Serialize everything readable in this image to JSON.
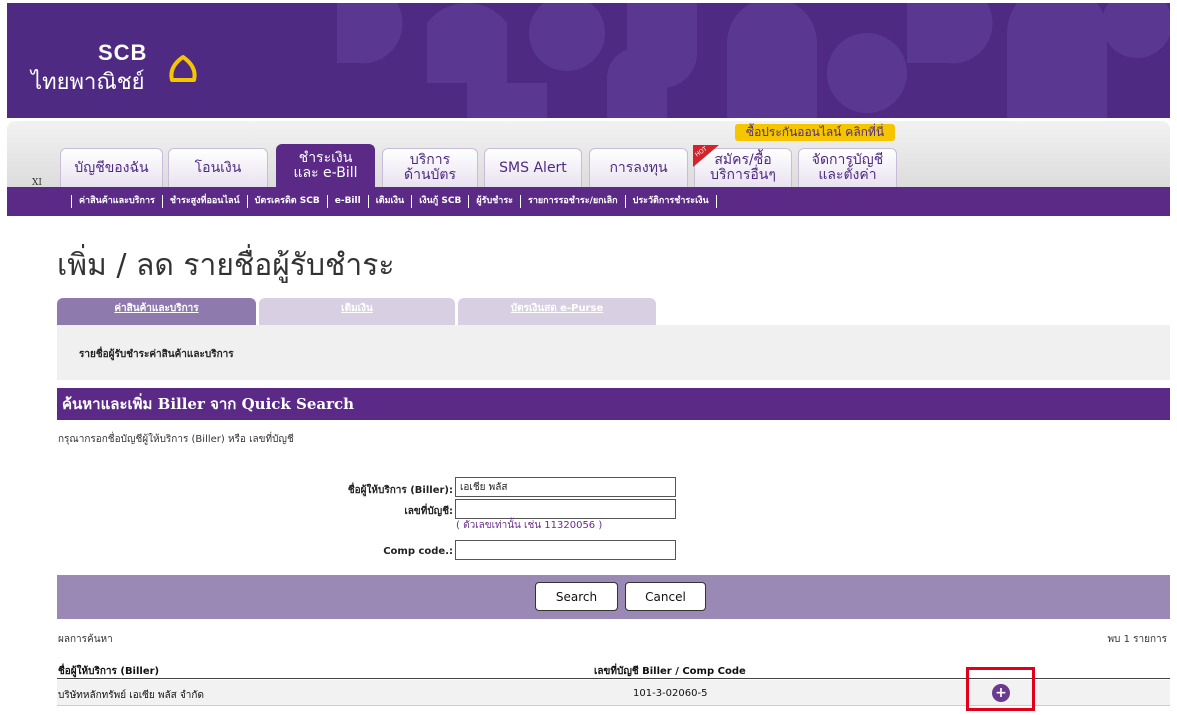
{
  "header": {
    "brand_en": "SCB",
    "brand_th": "ไทยพาณิชย์",
    "promo": "ซื้อประกันออนไลน์ คลิกที่นี่",
    "xi": "XI"
  },
  "nav_tabs": [
    {
      "label": "บัญชีของฉัน"
    },
    {
      "label": "โอนเงิน"
    },
    {
      "label": "ชำระเงิน\nและ e-Bill"
    },
    {
      "label": "บริการ\nด้านบัตร"
    },
    {
      "label": "SMS Alert"
    },
    {
      "label": "การลงทุน"
    },
    {
      "label": "สมัคร/ซื้อ\nบริการอื่นๆ"
    },
    {
      "label": "จัดการบัญชี\nและตั้งค่า"
    }
  ],
  "submenu": [
    "ค่าสินค้าและบริการ",
    "ชำระสูงที่ออนไลน์",
    "บัตรเครดิต SCB",
    "e-Bill",
    "เติมเงิน",
    "เงินกู้ SCB",
    "ผู้รับชำระ",
    "รายการรอชำระ/ยกเลิก",
    "ประวัติการชำระเงิน"
  ],
  "page": {
    "title": "เพิ่ม / ลด รายชื่อผู้รับชำระ",
    "content_tabs": [
      "ค่าสินค้าและบริการ",
      "เติมเงิน",
      "บัตรเงินสด e-Purse"
    ],
    "panel_label": "รายชื่อผู้รับชำระค่าสินค้าและบริการ",
    "section_header": "ค้นหาและเพิ่ม Biller จาก Quick Search",
    "instruction": "กรุณากรอกชื่อบัญชีผู้ให้บริการ (Biller) หรือ เลขที่บัญชี"
  },
  "form": {
    "biller_label": "ชื่อผู้ให้บริการ (Biller):",
    "biller_value": "เอเชีย พลัส",
    "account_label": "เลขที่บัญชี:",
    "account_value": "",
    "hint": "( ตัวเลขเท่านั้น เช่น 11320056 )",
    "comp_label": "Comp code.:",
    "comp_value": ""
  },
  "buttons": {
    "search": "Search",
    "cancel": "Cancel"
  },
  "results": {
    "label": "ผลการค้นหา",
    "count": "พบ 1 รายการ",
    "columns": [
      "ชื่อผู้ให้บริการ (Biller)",
      "เลขที่บัญชี Biller / Comp Code"
    ],
    "rows": [
      {
        "name": "บริษัทหลักทรัพย์ เอเซีย พลัส จำกัด",
        "account": "101-3-02060-5"
      }
    ],
    "add_icon": "+"
  },
  "colors": {
    "brand_purple": "#5b2a86",
    "promo_yellow": "#f5c600",
    "highlight_red": "#e0001b"
  }
}
